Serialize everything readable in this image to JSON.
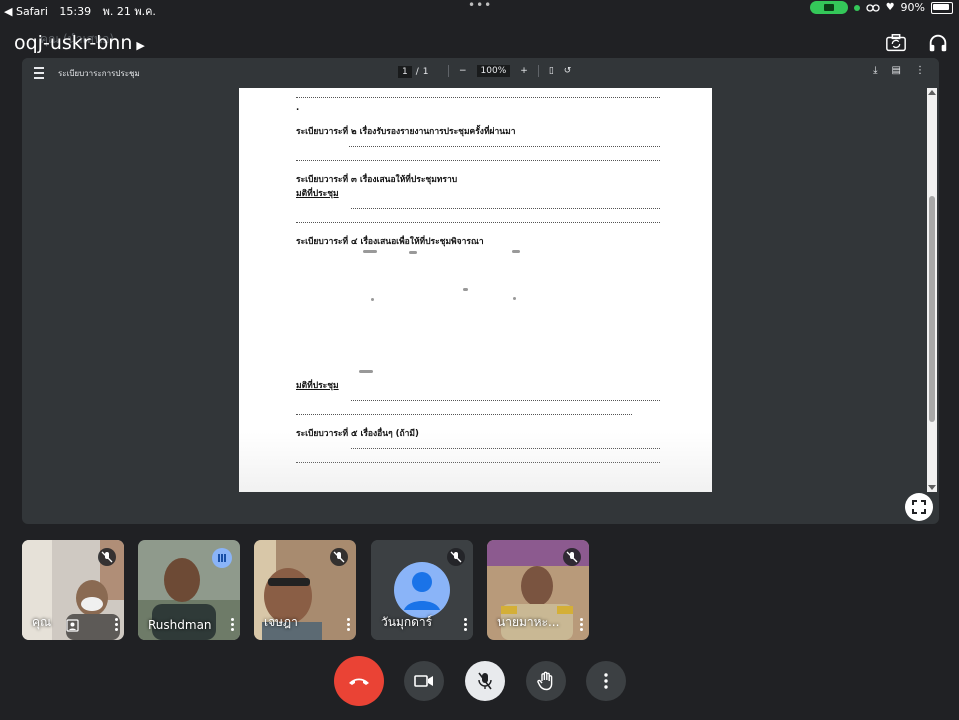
{
  "status_bar": {
    "back_app": "◀ Safari",
    "time": "15:39",
    "date": "พ. 21 พ.ค.",
    "battery": "90%"
  },
  "meeting": {
    "code": "oqj-uskr-bnn",
    "presenter_label": "คุณ (นำเสนอ)"
  },
  "pdf": {
    "title": "ระเบียบวาระการประชุม",
    "page_current": "1",
    "page_total": "1",
    "page_separator": "/",
    "zoom": "100%",
    "lines": {
      "agenda2": "ระเบียบวาระที่ ๒  เรื่องรับรองรายงานการประชุมครั้งที่ผ่านมา",
      "agenda3": "ระเบียบวาระที่ ๓  เรื่องเสนอให้ที่ประชุมทราบ",
      "resolution1": "มติที่ประชุม",
      "agenda4": "ระเบียบวาระที่ ๔  เรื่องเสนอเพื่อให้ที่ประชุมพิจารณา",
      "resolution2": "มติที่ประชุม",
      "agenda5": "ระเบียบวาระที่ ๕  เรื่องอื่นๆ (ถ้ามี)",
      "dot": "."
    }
  },
  "participants": [
    {
      "name": "คุณ",
      "muted": true
    },
    {
      "name": "Rushdman",
      "muted": false
    },
    {
      "name": "เจษฎา",
      "muted": true
    },
    {
      "name": "วันมุกดาร์",
      "muted": true
    },
    {
      "name": "นายมาหะ...",
      "muted": true
    }
  ],
  "colors": {
    "background": "#202124",
    "end_call": "#ea4335",
    "accent_blue": "#8ab4f8",
    "status_green": "#34c759"
  },
  "icons": {
    "top": [
      "switch-camera-icon",
      "headphones-icon"
    ],
    "controls": [
      "end-call-icon",
      "camera-icon",
      "mic-off-icon",
      "raise-hand-icon",
      "more-options-icon"
    ]
  }
}
